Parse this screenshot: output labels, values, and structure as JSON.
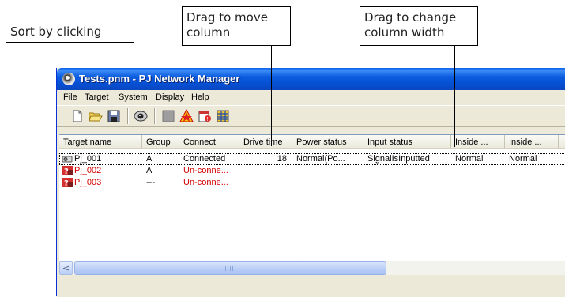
{
  "callouts": {
    "sort": "Sort by clicking",
    "move_line1": "Drag to move",
    "move_line2": "column",
    "width_line1": "Drag  to  change",
    "width_line2": "column width"
  },
  "window": {
    "title": "Tests.pnm - PJ Network Manager",
    "menu": [
      "File",
      "Target",
      "System",
      "Display",
      "Help"
    ],
    "toolbar_icons": [
      "new-file-icon",
      "open-folder-icon",
      "save-icon",
      "eye-monitor-icon",
      "gray-square-icon",
      "warning-star-icon",
      "calendar-alert-icon",
      "grid-table-icon"
    ]
  },
  "table": {
    "columns": [
      "Target name",
      "Group",
      "Connect",
      "Drive time",
      "Power status",
      "Input status",
      "Inside ...",
      "Inside ..."
    ],
    "rows": [
      {
        "name": "Pj_001",
        "group": "A",
        "connect": "Connected",
        "drive": "18",
        "power": "Normal(Po...",
        "input": "SignalIsInputted",
        "inside1": "Normal",
        "inside2": "Normal",
        "status": "ok"
      },
      {
        "name": "Pj_002",
        "group": "A",
        "connect": "Un-conne...",
        "drive": "",
        "power": "",
        "input": "",
        "inside1": "",
        "inside2": "",
        "status": "error"
      },
      {
        "name": "Pj_003",
        "group": "---",
        "connect": "Un-conne...",
        "drive": "",
        "power": "",
        "input": "",
        "inside1": "",
        "inside2": "",
        "status": "error"
      }
    ]
  },
  "colors": {
    "error_text": "#d40000",
    "normal_text": "#000000",
    "titlebar": "#0a5ae0"
  },
  "scrollbar": {
    "left_arrow": "<",
    "grip": "III"
  }
}
